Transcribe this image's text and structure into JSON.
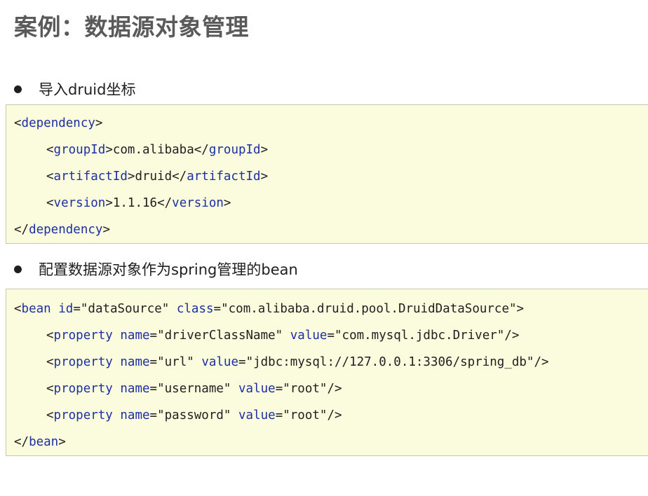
{
  "page": {
    "title": "案例：数据源对象管理"
  },
  "sections": [
    {
      "bullet": "导入druid坐标",
      "code": {
        "root_tag": "dependency",
        "children": [
          {
            "tag": "groupId",
            "text": "com.alibaba"
          },
          {
            "tag": "artifactId",
            "text": "druid"
          },
          {
            "tag": "version",
            "text": "1.1.16"
          }
        ]
      }
    },
    {
      "bullet": "配置数据源对象作为spring管理的bean",
      "code": {
        "root_tag": "bean",
        "root_attrs": [
          {
            "name": "id",
            "value": "\"dataSource\""
          },
          {
            "name": "class",
            "value": "\"com.alibaba.druid.pool.DruidDataSource\""
          }
        ],
        "properties": [
          {
            "tag": "property",
            "name_attr": "name",
            "name_value": "\"driverClassName\"",
            "value_attr": "value",
            "value_value": "\"com.mysql.jdbc.Driver\""
          },
          {
            "tag": "property",
            "name_attr": "name",
            "name_value": "\"url\"",
            "value_attr": "value",
            "value_value": "\"jdbc:mysql://127.0.0.1:3306/spring_db\""
          },
          {
            "tag": "property",
            "name_attr": "name",
            "name_value": "\"username\"",
            "value_attr": "value",
            "value_value": "\"root\""
          },
          {
            "tag": "property",
            "name_attr": "name",
            "name_value": "\"password\"",
            "value_attr": "value",
            "value_value": "\"root\""
          }
        ]
      }
    }
  ],
  "colors": {
    "code_background": "#fbfbde",
    "code_tag": "#1c2fa3",
    "title_text": "#5a5a5a"
  }
}
